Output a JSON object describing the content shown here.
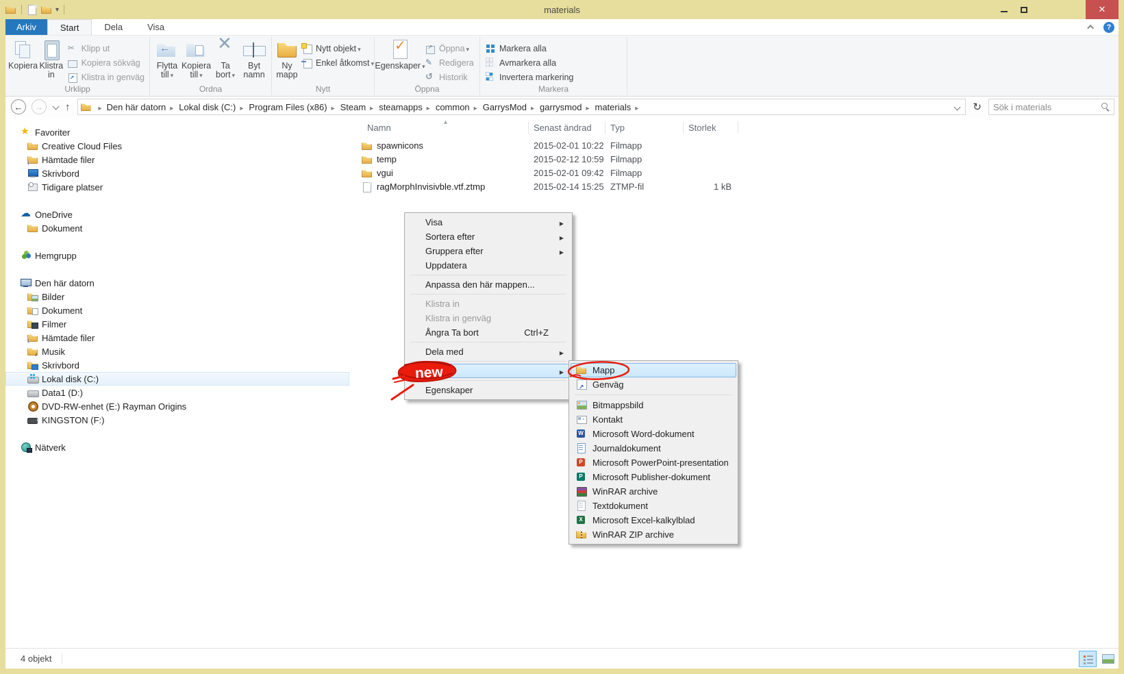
{
  "window": {
    "title": "materials"
  },
  "icons": {
    "minimize": "–",
    "close": "✕",
    "help": "?",
    "back": "←",
    "forward": "→",
    "up": "↑",
    "refresh": "↻",
    "caret_down": "▾",
    "menu_arrow": "▶",
    "sort_asc": "▴"
  },
  "colors": {
    "titlebar_tan": "#e7dd9d",
    "close_red": "#c75050",
    "tab_blue": "#2678be",
    "selection_blue": "#cbe7fb",
    "annotation_red": "#ea1c0d",
    "ribbon_bg": "#f5f6f7"
  },
  "tabs": {
    "file": "Arkiv",
    "items": [
      {
        "label": "Start",
        "state": "active"
      },
      {
        "label": "Dela"
      },
      {
        "label": "Visa"
      }
    ]
  },
  "ribbon": {
    "clipboard": {
      "label": "Urklipp",
      "copy": "Kopiera",
      "paste": "Klistra in",
      "cut": "Klipp ut",
      "copy_path": "Kopiera sökväg",
      "paste_shortcut": "Klistra in genväg"
    },
    "organize": {
      "label": "Ordna",
      "move_to": "Flytta till",
      "copy_to": "Kopiera till",
      "delete": "Ta bort",
      "rename": "Byt namn"
    },
    "new": {
      "label": "Nytt",
      "new_folder": "Ny mapp",
      "new_item": "Nytt objekt",
      "easy_access": "Enkel åtkomst"
    },
    "open": {
      "label": "Öppna",
      "properties": "Egenskaper",
      "open": "Öppna",
      "edit": "Redigera",
      "history": "Historik"
    },
    "select": {
      "label": "Markera",
      "select_all": "Markera alla",
      "select_none": "Avmarkera alla",
      "invert": "Invertera markering"
    }
  },
  "address": {
    "crumbs": [
      {
        "label": "Den här datorn"
      },
      {
        "label": "Lokal disk (C:)"
      },
      {
        "label": "Program Files (x86)"
      },
      {
        "label": "Steam"
      },
      {
        "label": "steamapps"
      },
      {
        "label": "common"
      },
      {
        "label": "GarrysMod"
      },
      {
        "label": "garrysmod"
      },
      {
        "label": "materials"
      }
    ],
    "search_placeholder": "Sök i materials"
  },
  "sidebar": {
    "items": [
      {
        "label": "Favoriter",
        "icon": "star",
        "indent": 0
      },
      {
        "label": "Creative Cloud Files",
        "icon": "folder",
        "indent": 1
      },
      {
        "label": "Hämtade filer",
        "icon": "folder-down",
        "indent": 1
      },
      {
        "label": "Skrivbord",
        "icon": "desktop",
        "indent": 1
      },
      {
        "label": "Tidigare platser",
        "icon": "history",
        "indent": 1
      },
      {
        "label": "OneDrive",
        "icon": "cloud",
        "indent": 0,
        "gap": true
      },
      {
        "label": "Dokument",
        "icon": "folder",
        "indent": 1
      },
      {
        "label": "Hemgrupp",
        "icon": "homegroup",
        "indent": 0,
        "gap": true
      },
      {
        "label": "Den här datorn",
        "icon": "computer",
        "indent": 0,
        "gap": true
      },
      {
        "label": "Bilder",
        "icon": "folder-pic",
        "indent": 1
      },
      {
        "label": "Dokument",
        "icon": "folder-doc",
        "indent": 1
      },
      {
        "label": "Filmer",
        "icon": "folder-vid",
        "indent": 1
      },
      {
        "label": "Hämtade filer",
        "icon": "folder-down",
        "indent": 1
      },
      {
        "label": "Musik",
        "icon": "folder-music",
        "indent": 1
      },
      {
        "label": "Skrivbord",
        "icon": "folder-desk",
        "indent": 1
      },
      {
        "label": "Lokal disk (C:)",
        "icon": "disk-win",
        "indent": 1,
        "state": "selected"
      },
      {
        "label": "Data1 (D:)",
        "icon": "disk",
        "indent": 1
      },
      {
        "label": "DVD-RW-enhet (E:) Rayman Origins",
        "icon": "disc",
        "indent": 1
      },
      {
        "label": "KINGSTON (F:)",
        "icon": "usb",
        "indent": 1
      },
      {
        "label": "Nätverk",
        "icon": "network",
        "indent": 0,
        "gap": true
      }
    ]
  },
  "file_list": {
    "columns": {
      "name": "Namn",
      "date": "Senast ändrad",
      "type": "Typ",
      "size": "Storlek"
    },
    "rows": [
      {
        "name": "spawnicons",
        "icon": "folder",
        "date": "2015-02-01 10:22",
        "type": "Filmapp",
        "size": ""
      },
      {
        "name": "temp",
        "icon": "folder",
        "date": "2015-02-12 10:59",
        "type": "Filmapp",
        "size": ""
      },
      {
        "name": "vgui",
        "icon": "folder",
        "date": "2015-02-01 09:42",
        "type": "Filmapp",
        "size": ""
      },
      {
        "name": "ragMorphInvisivble.vtf.ztmp",
        "icon": "file",
        "date": "2015-02-14 15:25",
        "type": "ZTMP-fil",
        "size": "1 kB"
      }
    ]
  },
  "context_menu": {
    "items": [
      {
        "label": "Visa",
        "arrow": true
      },
      {
        "label": "Sortera efter",
        "arrow": true
      },
      {
        "label": "Gruppera efter",
        "arrow": true
      },
      {
        "label": "Uppdatera"
      },
      {
        "sep": true
      },
      {
        "label": "Anpassa den här mappen..."
      },
      {
        "sep": true
      },
      {
        "label": "Klistra in",
        "state": "disabled"
      },
      {
        "label": "Klistra in genväg",
        "state": "disabled"
      },
      {
        "label": "Ångra Ta bort",
        "shortcut": "Ctrl+Z"
      },
      {
        "sep": true
      },
      {
        "label": "Dela med",
        "arrow": true
      },
      {
        "sep": true
      },
      {
        "label": "",
        "arrow": true,
        "state": "selected annotated"
      },
      {
        "sep": true
      },
      {
        "label": "Egenskaper"
      }
    ]
  },
  "new_submenu": {
    "items": [
      {
        "label": "Mapp",
        "icon": "folder",
        "state": "selected"
      },
      {
        "label": "Genväg",
        "icon": "shortcut"
      },
      {
        "sep": true
      },
      {
        "label": "Bitmappsbild",
        "icon": "bitmap"
      },
      {
        "label": "Kontakt",
        "icon": "contact"
      },
      {
        "label": "Microsoft Word-dokument",
        "icon": "word"
      },
      {
        "label": "Journaldokument",
        "icon": "journal"
      },
      {
        "label": "Microsoft PowerPoint-presentation",
        "icon": "powerpoint"
      },
      {
        "label": "Microsoft Publisher-dokument",
        "icon": "publisher"
      },
      {
        "label": "WinRAR archive",
        "icon": "winrar"
      },
      {
        "label": "Textdokument",
        "icon": "textfile"
      },
      {
        "label": "Microsoft Excel-kalkylblad",
        "icon": "excel"
      },
      {
        "label": "WinRAR ZIP archive",
        "icon": "zip"
      }
    ]
  },
  "status_bar": {
    "items_count": "4 objekt"
  },
  "annotations": {
    "new_text": "new"
  }
}
